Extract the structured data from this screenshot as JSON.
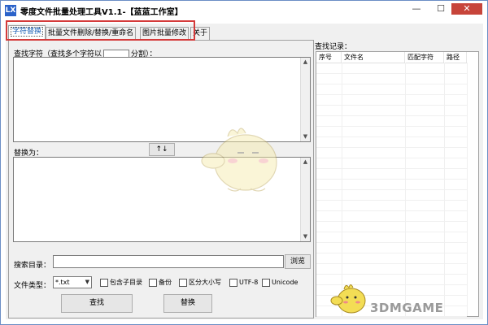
{
  "window": {
    "title": "零度文件批量处理工具V1.1-【蓝蓝工作室】",
    "icon": "app-icon",
    "app_icon_text": "LX",
    "controls": {
      "minimize": "—",
      "maximize": "☐",
      "close": "✕"
    }
  },
  "tabs": [
    {
      "label": "字符替换",
      "active": true
    },
    {
      "label": "批量文件删除/替换/重命名",
      "active": false
    },
    {
      "label": "图片批量修改",
      "active": false
    },
    {
      "label": "关于",
      "active": false
    }
  ],
  "find_section": {
    "label_prefix": "查找字符（查找多个字符以",
    "label_suffix": "分割）：",
    "separator_value": ""
  },
  "replace_section": {
    "label": "替换为：",
    "swap_button": "↑↓"
  },
  "search_dir": {
    "label": "搜索目录：",
    "value": "",
    "browse_button": "浏览"
  },
  "file_type": {
    "label": "文件类型：",
    "selected": "*.txt"
  },
  "options": [
    {
      "label": "包含子目录",
      "checked": false
    },
    {
      "label": "备份",
      "checked": false
    },
    {
      "label": "区分大小写",
      "checked": false
    },
    {
      "label": "UTF-8",
      "checked": false
    },
    {
      "label": "Unicode",
      "checked": false
    }
  ],
  "actions": {
    "find_button": "查找",
    "replace_button": "替换"
  },
  "results": {
    "label": "查找记录：",
    "columns": [
      "序号",
      "文件名",
      "匹配字符",
      "路径"
    ]
  },
  "watermark": "3DMGAME",
  "colors": {
    "highlight": "#d43a3a",
    "active_tab_text": "#1a5fb4",
    "close_button": "#c7443a"
  }
}
